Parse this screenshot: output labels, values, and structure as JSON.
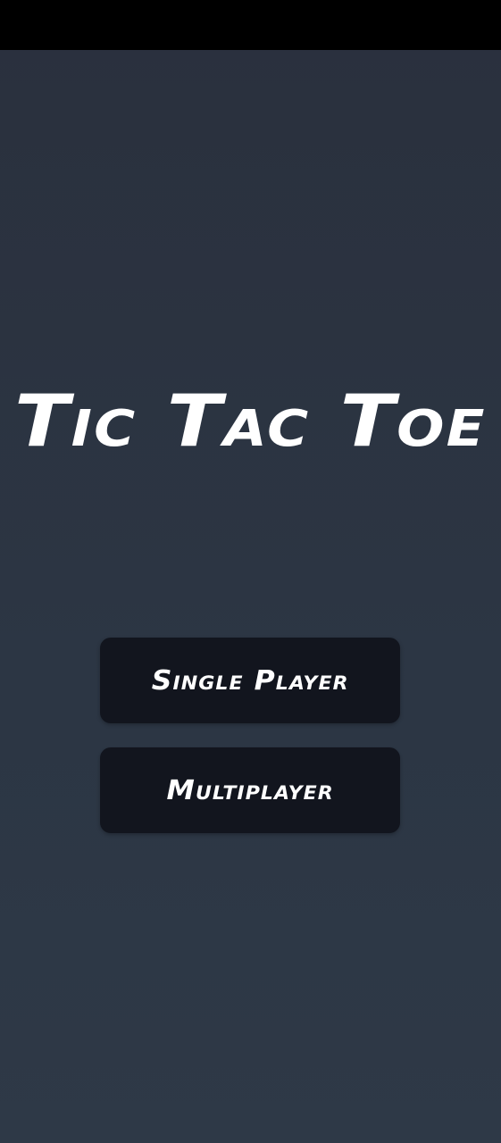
{
  "app": {
    "title": "Tic Tac Toe"
  },
  "menu": {
    "single_player_label": "Single Player",
    "multiplayer_label": "Multiplayer"
  },
  "colors": {
    "status_bar": "#000000",
    "background_top": "#2a303d",
    "background_bottom": "#2e3947",
    "button_background": "#12151e",
    "text": "#ffffff"
  }
}
